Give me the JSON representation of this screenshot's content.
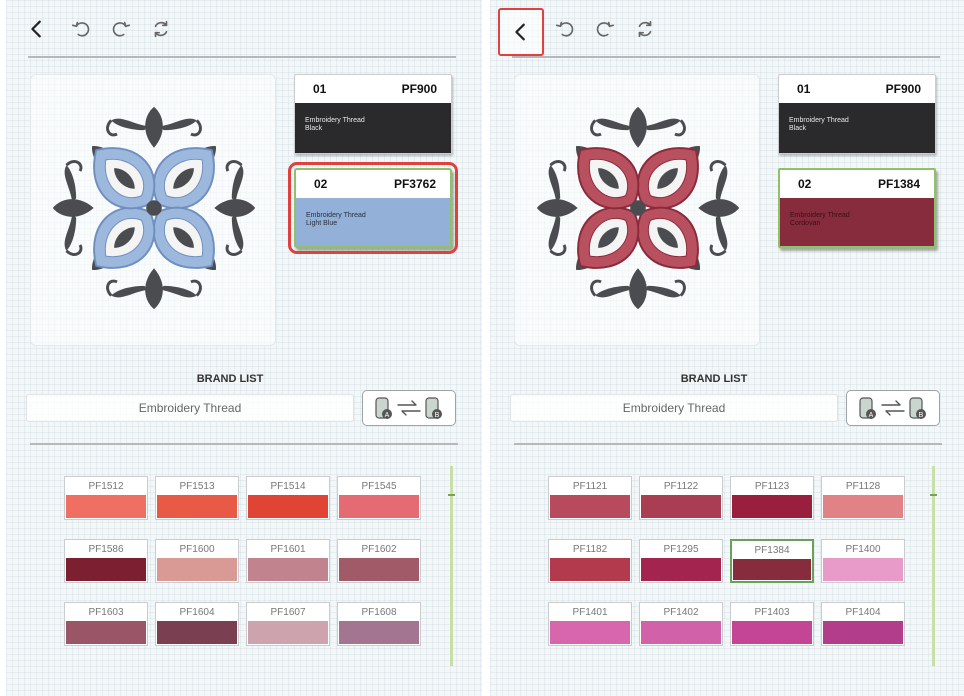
{
  "panels": [
    {
      "toolbar": {
        "back_icon": "back-icon",
        "undo_icon": "undo-icon",
        "redo_icon": "redo-icon",
        "reset_icon": "reset-icon"
      },
      "cards": [
        {
          "number": "01",
          "code": "PF900",
          "brand": "Embroidery Thread",
          "name": "Black",
          "color": "#2a2a2c"
        },
        {
          "number": "02",
          "code": "PF3762",
          "brand": "Embroidery Thread",
          "name": "Light Blue",
          "color": "#93b0d8"
        }
      ],
      "pattern_accent": "#9db8dd",
      "pattern_accent_stroke": "#6f8fbf",
      "brand_list_title": "BRAND LIST",
      "brand_value": "Embroidery Thread",
      "swatches": [
        {
          "code": "PF1512",
          "color": "#ef6f62"
        },
        {
          "code": "PF1513",
          "color": "#e85a45"
        },
        {
          "code": "PF1514",
          "color": "#df4434"
        },
        {
          "code": "PF1545",
          "color": "#e46a74"
        },
        {
          "code": "PF1586",
          "color": "#7b1f31"
        },
        {
          "code": "PF1600",
          "color": "#d99a95"
        },
        {
          "code": "PF1601",
          "color": "#c1838d"
        },
        {
          "code": "PF1602",
          "color": "#a05a68"
        },
        {
          "code": "PF1603",
          "color": "#9a5566"
        },
        {
          "code": "PF1604",
          "color": "#7b3f52"
        },
        {
          "code": "PF1607",
          "color": "#cda3ad"
        },
        {
          "code": "PF1608",
          "color": "#a47590"
        }
      ]
    },
    {
      "toolbar": {
        "back_icon": "back-icon",
        "undo_icon": "undo-icon",
        "redo_icon": "redo-icon",
        "reset_icon": "reset-icon"
      },
      "cards": [
        {
          "number": "01",
          "code": "PF900",
          "brand": "Embroidery Thread",
          "name": "Black",
          "color": "#2a2a2c"
        },
        {
          "number": "02",
          "code": "PF1384",
          "brand": "Embroidery Thread",
          "name": "Cordovan",
          "color": "#862c3c"
        }
      ],
      "pattern_accent": "#b9505f",
      "pattern_accent_stroke": "#8a2b3a",
      "brand_list_title": "BRAND LIST",
      "brand_value": "Embroidery Thread",
      "swatches": [
        {
          "code": "PF1121",
          "color": "#b84a5e"
        },
        {
          "code": "PF1122",
          "color": "#a93d52"
        },
        {
          "code": "PF1123",
          "color": "#9a1f3e"
        },
        {
          "code": "PF1128",
          "color": "#e08286"
        },
        {
          "code": "PF1182",
          "color": "#b23a4c"
        },
        {
          "code": "PF1295",
          "color": "#a3244e"
        },
        {
          "code": "PF1384",
          "color": "#862c3c"
        },
        {
          "code": "PF1400",
          "color": "#e89ac8"
        },
        {
          "code": "PF1401",
          "color": "#d766ac"
        },
        {
          "code": "PF1402",
          "color": "#d162a9"
        },
        {
          "code": "PF1403",
          "color": "#c44596"
        },
        {
          "code": "PF1404",
          "color": "#b23d8a"
        }
      ]
    }
  ]
}
